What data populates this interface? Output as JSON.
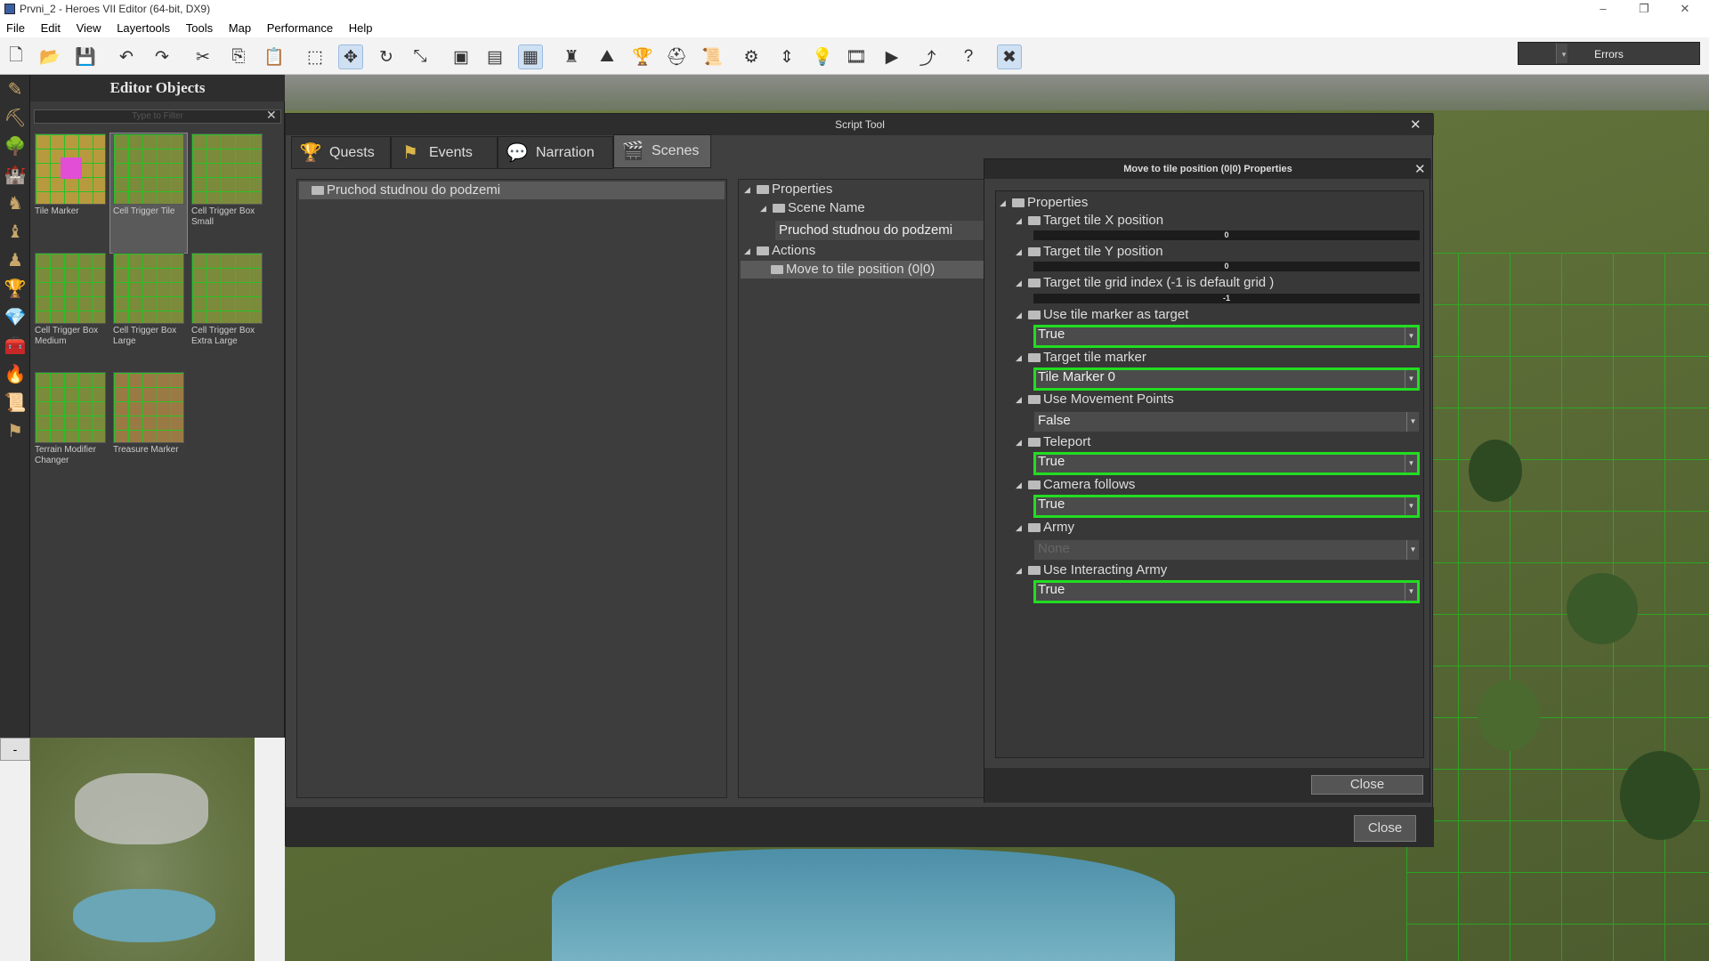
{
  "window": {
    "title": "Prvni_2 - Heroes VII Editor (64-bit, DX9)",
    "minimize": "–",
    "restore": "❐",
    "close": "✕"
  },
  "menu": [
    "File",
    "Edit",
    "View",
    "Layertools",
    "Tools",
    "Map",
    "Performance",
    "Help"
  ],
  "toolbar": {
    "errors_label": "Errors",
    "errors_arrow": "▾"
  },
  "editor_objects": {
    "title": "Editor Objects",
    "filter_placeholder": "Type to Filter",
    "clear": "✕",
    "items": [
      {
        "label": "Tile Marker"
      },
      {
        "label": "Cell Trigger Tile"
      },
      {
        "label": "Cell Trigger Box Small"
      },
      {
        "label": "Cell Trigger Box Medium"
      },
      {
        "label": "Cell Trigger Box Large"
      },
      {
        "label": "Cell Trigger Box Extra Large"
      },
      {
        "label": "Terrain Modifier Changer"
      },
      {
        "label": "Treasure Marker"
      }
    ],
    "selected_index": 1
  },
  "minimap": {
    "toggle": "-"
  },
  "script_tool": {
    "title": "Script Tool",
    "close_x": "✕",
    "tabs": [
      {
        "label": "Quests",
        "icon": "trophy-icon"
      },
      {
        "label": "Events",
        "icon": "events-icon"
      },
      {
        "label": "Narration",
        "icon": "narration-icon"
      },
      {
        "label": "Scenes",
        "icon": "scenes-icon"
      }
    ],
    "active_tab": "Scenes",
    "scene_list": [
      "Pruchod studnou do podzemi"
    ],
    "tree": {
      "properties": "Properties",
      "scene_name_label": "Scene Name",
      "scene_name_value": "Pruchod studnou do podzemi",
      "actions": "Actions",
      "action_item": "Move to tile position (0|0)"
    },
    "close_button": "Close"
  },
  "properties_dialog": {
    "title": "Move to tile position (0|0) Properties",
    "close_x": "✕",
    "root": "Properties",
    "fields": {
      "target_x": {
        "label": "Target tile X position",
        "value": "0"
      },
      "target_y": {
        "label": "Target tile Y position",
        "value": "0"
      },
      "grid_index": {
        "label": "Target tile grid index (-1 is default grid )",
        "value": "-1"
      },
      "use_marker": {
        "label": "Use tile marker as target",
        "value": "True"
      },
      "tile_marker": {
        "label": "Target tile marker",
        "value": "Tile Marker 0"
      },
      "movement_points": {
        "label": "Use Movement Points",
        "value": "False"
      },
      "teleport": {
        "label": "Teleport",
        "value": "True"
      },
      "camera_follows": {
        "label": "Camera follows",
        "value": "True"
      },
      "army": {
        "label": "Army",
        "value": "None"
      },
      "interacting_army": {
        "label": "Use Interacting Army",
        "value": "True"
      }
    },
    "close_button": "Close"
  },
  "colors": {
    "highlight": "#22dd22",
    "panel": "#3e3e3e",
    "header": "#2a2a2a"
  }
}
